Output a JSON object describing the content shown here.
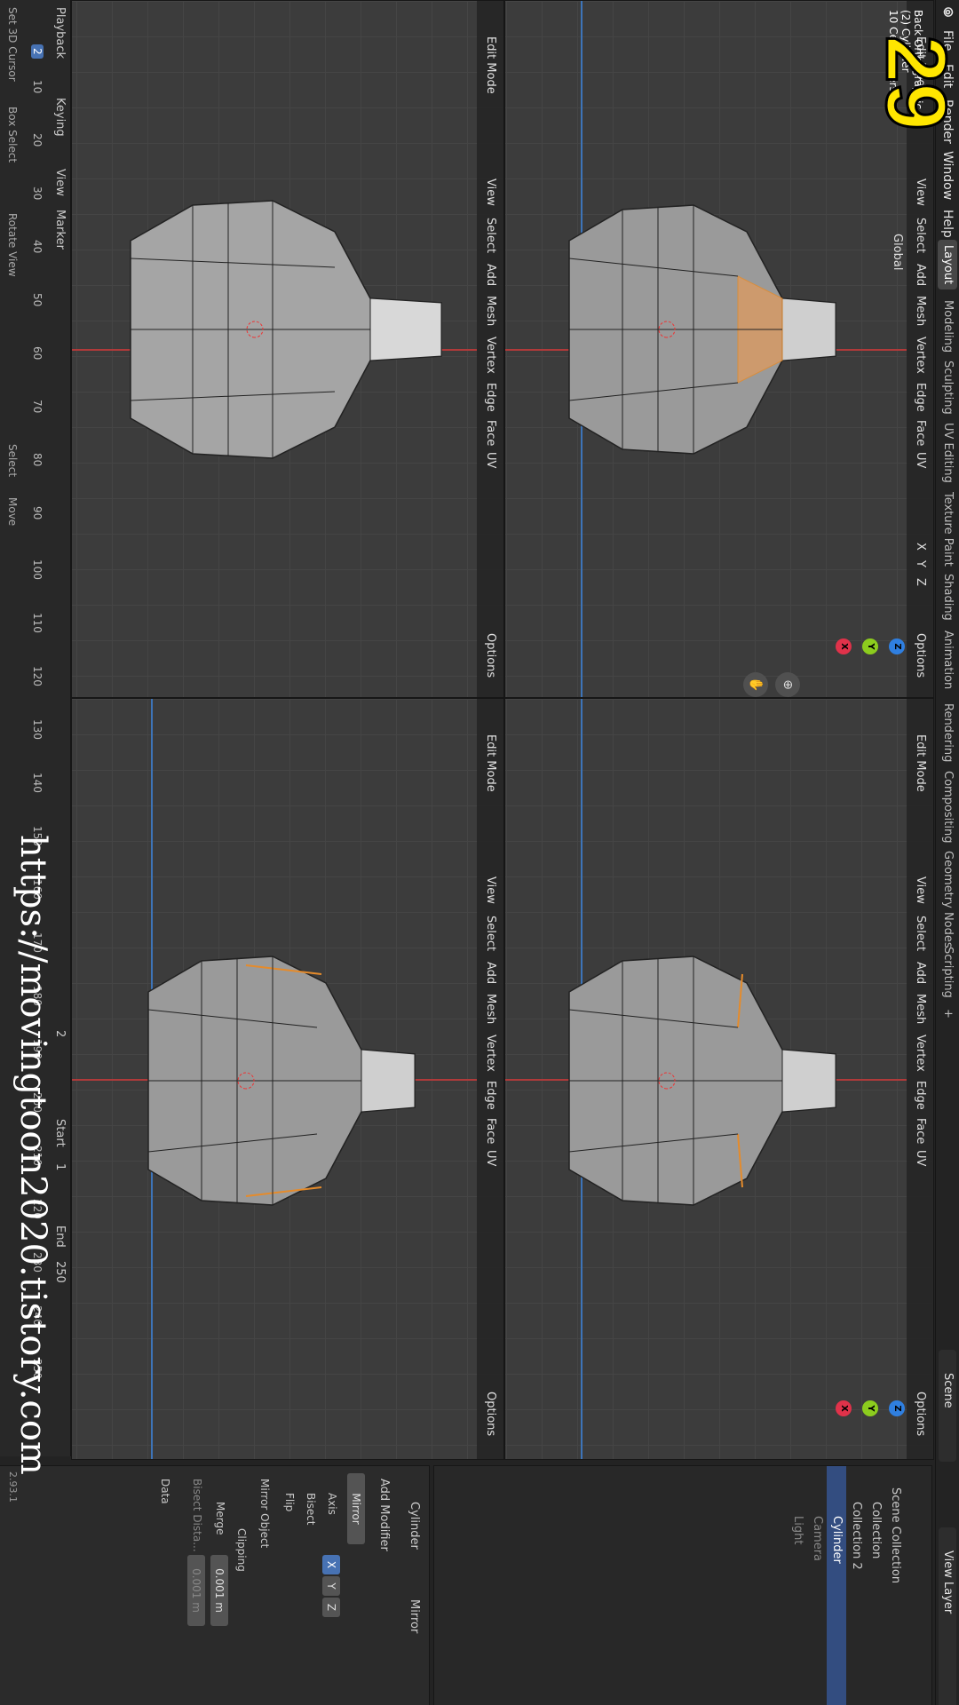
{
  "app": {
    "version": "2.93.1"
  },
  "menu": [
    "File",
    "Edit",
    "Render",
    "Window",
    "Help"
  ],
  "workspaces": [
    "Layout",
    "Modeling",
    "Sculpting",
    "UV Editing",
    "Texture Paint",
    "Shading",
    "Animation",
    "Rendering",
    "Compositing",
    "Geometry Nodes",
    "Scripting",
    "+"
  ],
  "scene": {
    "label": "Scene",
    "view_layer": "View Layer"
  },
  "viewport_header": {
    "mode": "Edit Mode",
    "menus": [
      "View",
      "Select",
      "Add",
      "Mesh",
      "Vertex",
      "Edge",
      "Face",
      "UV"
    ],
    "orientation": "Global",
    "options": "Options",
    "axes": [
      "X",
      "Y",
      "Z"
    ]
  },
  "hud": {
    "line1": "Back Orthographic",
    "line2": "(2) Cylinder",
    "line3": "10 Centimeters"
  },
  "gizmo": {
    "top": "Z",
    "mid": "Y",
    "bottom": "X",
    "colors": {
      "x": "#e0324a",
      "y": "#8ccc1e",
      "z": "#2f7fe0"
    }
  },
  "timeline": {
    "playback": "Playback",
    "keying": "Keying",
    "view": "View",
    "marker": "Marker",
    "current_frame": "2",
    "frame_field": "2",
    "start_label": "Start",
    "start": "1",
    "end_label": "End",
    "end": "250",
    "ticks": [
      "10",
      "20",
      "30",
      "40",
      "50",
      "60",
      "70",
      "80",
      "90",
      "100",
      "110",
      "120",
      "130",
      "140",
      "150",
      "160",
      "170",
      "180",
      "190",
      "200",
      "210",
      "220",
      "230",
      "240",
      "250"
    ]
  },
  "status_bar": [
    "Set 3D Cursor",
    "Box Select",
    "Rotate View",
    "Select",
    "Move"
  ],
  "outliner": {
    "title": "Scene Collection",
    "items": [
      "Collection",
      "Collection 2",
      "Cylinder",
      "Camera",
      "Light"
    ]
  },
  "properties": {
    "object": "Cylinder",
    "modifier": "Mirror",
    "add_modifier": "Add Modifier",
    "mod_name": "Mirror",
    "axis_label": "Axis",
    "bisect_label": "Bisect",
    "flip_label": "Flip",
    "mirror_object": "Mirror Object",
    "clipping": "Clipping",
    "merge": "Merge",
    "merge_value": "0.001 m",
    "bisect_distance": "Bisect Dista...",
    "bisect_value": "0.001 m",
    "data": "Data"
  },
  "overlay": {
    "tutorial_number": "29",
    "watermark": "https://movingtoon2020.tistory.com"
  }
}
